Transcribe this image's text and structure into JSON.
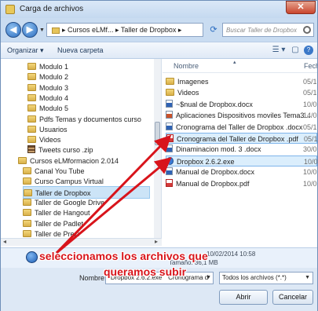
{
  "window": {
    "title": "Carga de archivos",
    "close_glyph": "✕"
  },
  "nav": {
    "back_glyph": "◀",
    "forward_glyph": "▶",
    "dropdown_glyph": "▼",
    "path": "▸ Cursos eLMf... ▸ Taller de Dropbox ▸",
    "refresh_glyph": "⟳",
    "search_placeholder": "Buscar Taller de Dropbox"
  },
  "toolbar": {
    "organize": "Organizar ▾",
    "new_folder": "Nueva carpeta",
    "view_glyph": "☰ ▾",
    "pane_glyph": "▢",
    "help_glyph": "?"
  },
  "tree": [
    {
      "label": "Modulo 1",
      "icon": "folder"
    },
    {
      "label": "Modulo 2",
      "icon": "folder"
    },
    {
      "label": "Modulo 3",
      "icon": "folder"
    },
    {
      "label": "Modulo 4",
      "icon": "folder"
    },
    {
      "label": "Modulo 5",
      "icon": "folder"
    },
    {
      "label": "Pdfs Temas y documentos curso",
      "icon": "folder"
    },
    {
      "label": "Usuarios",
      "icon": "folder"
    },
    {
      "label": "Videos",
      "icon": "folder"
    },
    {
      "label": "Tweets curso .zip",
      "icon": "zip"
    },
    {
      "label": "Cursos eLMformacion 2.014",
      "icon": "folder"
    },
    {
      "label": "Canal You Tube",
      "icon": "folder"
    },
    {
      "label": "Curso Campus Virtual",
      "icon": "folder"
    },
    {
      "label": "Taller de Dropbox",
      "icon": "folder",
      "selected": true
    },
    {
      "label": "Taller de Google Drive",
      "icon": "folder"
    },
    {
      "label": "Taller de Hangout",
      "icon": "folder"
    },
    {
      "label": "Taller de Padlet",
      "icon": "folder"
    },
    {
      "label": "Taller de Prezi",
      "icon": "folder"
    }
  ],
  "columns": {
    "name": "Nombre",
    "date": "Fech"
  },
  "files": [
    {
      "name": "Imagenes",
      "icon": "folder",
      "date": "05/1"
    },
    {
      "name": "Videos",
      "icon": "folder",
      "date": "05/1"
    },
    {
      "name": "~$nual de Dropbox.docx",
      "icon": "doc",
      "date": "10/0"
    },
    {
      "name": "Aplicaciones Dispositivos moviles Tema3...",
      "icon": "ppt",
      "date": "14/0"
    },
    {
      "name": "Cronograma del Taller de Dropbox .docx",
      "icon": "doc",
      "date": "05/1"
    },
    {
      "name": "Cronograma del Taller de Dropbox .pdf",
      "icon": "pdf",
      "date": "05/1",
      "selected": true
    },
    {
      "name": "Dinaminacion mod. 3 .docx",
      "icon": "doc",
      "date": "30/0"
    },
    {
      "name": "Dropbox 2.6.2.exe",
      "icon": "exe",
      "date": "10/0",
      "selected": true
    },
    {
      "name": "Manual de Dropbox.docx",
      "icon": "doc",
      "date": "10/0"
    },
    {
      "name": "Manual de Dropbox.pdf",
      "icon": "pdf",
      "date": "10/0"
    }
  ],
  "details": {
    "date": "10/02/2014 10:58",
    "size": "Tamaño: 36,1 MB"
  },
  "footer": {
    "name_label": "Nombre:",
    "name_value": "\"Dropbox 2.6.2.exe\" \"Cronograma d",
    "type_value": "Todos los archivos (*.*)",
    "open": "Abrir",
    "cancel": "Cancelar"
  },
  "annotation": {
    "line1": "seleccionamos los archivos que",
    "line2": "queramos subir",
    "color": "#d8141b"
  }
}
